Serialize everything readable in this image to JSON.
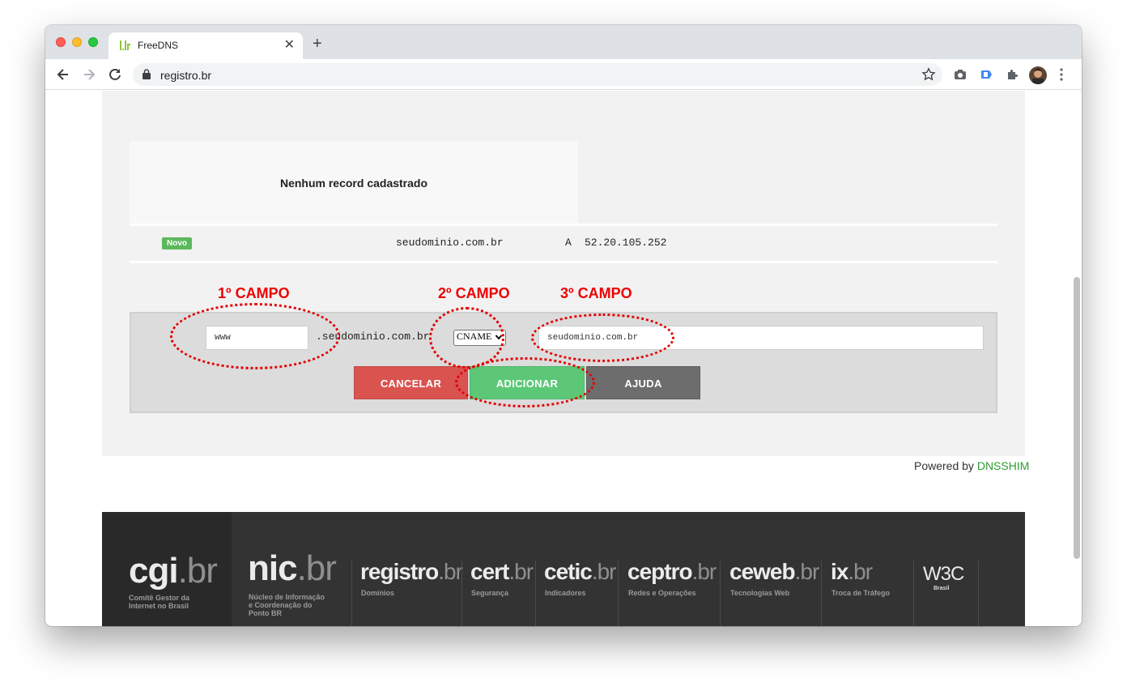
{
  "browser": {
    "tab_title": "FreeDNS",
    "new_tab": "+",
    "close": "✕",
    "url": "registro.br"
  },
  "records": {
    "empty_message": "Nenhum record cadastrado",
    "new_badge": "Novo",
    "new_record": {
      "name": "seudominio.com.br",
      "type": "A",
      "value": "52.20.105.252"
    }
  },
  "form": {
    "name_value": "www",
    "domain_suffix": ".seudominio.com.br",
    "type_selected": "CNAME",
    "target_value": "seudominio.com.br",
    "buttons": {
      "cancel": "CANCELAR",
      "add": "ADICIONAR",
      "help": "AJUDA"
    },
    "colors": {
      "cancel": "#d9534f",
      "add": "#5cc877",
      "help": "#6d6d6d"
    }
  },
  "annotations": {
    "field1": "1º CAMPO",
    "field2": "2º CAMPO",
    "field3": "3º CAMPO",
    "color": "#ee0000"
  },
  "powered": {
    "prefix": "Powered by",
    "link": "DNSSHIM"
  },
  "footer": {
    "logos": [
      {
        "name": "cgi",
        "main": "cgi",
        "br": ".br",
        "sub": [
          "Comitê Gestor da",
          "Internet no Brasil"
        ]
      },
      {
        "name": "nic",
        "main": "nic",
        "br": ".br",
        "sub": [
          "Núcleo de Informação",
          "e Coordenação do",
          "Ponto BR"
        ]
      },
      {
        "name": "registro",
        "main": "registro",
        "br": ".br",
        "sub": [
          "Domínios"
        ]
      },
      {
        "name": "cert",
        "main": "cert",
        "br": ".br",
        "sub": [
          "Segurança"
        ]
      },
      {
        "name": "cetic",
        "main": "cetic",
        "br": ".br",
        "sub": [
          "Indicadores"
        ]
      },
      {
        "name": "ceptro",
        "main": "ceptro",
        "br": ".br",
        "sub": [
          "Redes e Operações"
        ]
      },
      {
        "name": "ceweb",
        "main": "ceweb",
        "br": ".br",
        "sub": [
          "Tecnologias Web"
        ]
      },
      {
        "name": "ix",
        "main": "ix",
        "br": ".br",
        "sub": [
          "Troca de Tráfego"
        ]
      },
      {
        "name": "w3c",
        "main": "W3C",
        "br": "",
        "sub": [
          "Brasil"
        ]
      }
    ]
  }
}
